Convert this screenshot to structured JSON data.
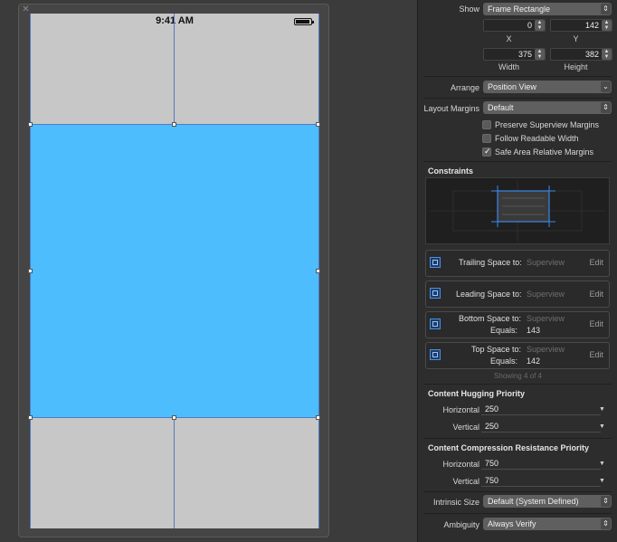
{
  "canvas": {
    "time": "9:41 AM"
  },
  "inspector": {
    "show_label": "Show",
    "show_value": "Frame Rectangle",
    "x_value": "0",
    "y_value": "142",
    "x_label": "X",
    "y_label": "Y",
    "width_value": "375",
    "height_value": "382",
    "width_label": "Width",
    "height_label": "Height",
    "arrange_label": "Arrange",
    "arrange_value": "Position View",
    "layout_margins_label": "Layout Margins",
    "layout_margins_value": "Default",
    "checkboxes": [
      {
        "label": "Preserve Superview Margins",
        "checked": false
      },
      {
        "label": "Follow Readable Width",
        "checked": false
      },
      {
        "label": "Safe Area Relative Margins",
        "checked": true
      }
    ],
    "constraints_title": "Constraints",
    "constraints": [
      {
        "label": "Trailing Space to:",
        "target": "Superview",
        "equals_label": "",
        "equals_value": "",
        "edit": "Edit"
      },
      {
        "label": "Leading Space to:",
        "target": "Superview",
        "equals_label": "",
        "equals_value": "",
        "edit": "Edit"
      },
      {
        "label": "Bottom Space to:",
        "target": "Superview",
        "equals_label": "Equals:",
        "equals_value": "143",
        "edit": "Edit"
      },
      {
        "label": "Top Space to:",
        "target": "Superview",
        "equals_label": "Equals:",
        "equals_value": "142",
        "edit": "Edit"
      }
    ],
    "showing_text": "Showing 4 of 4",
    "hugging_title": "Content Hugging Priority",
    "hugging_horizontal_label": "Horizontal",
    "hugging_horizontal_value": "250",
    "hugging_vertical_label": "Vertical",
    "hugging_vertical_value": "250",
    "compression_title": "Content Compression Resistance Priority",
    "compression_horizontal_label": "Horizontal",
    "compression_horizontal_value": "750",
    "compression_vertical_label": "Vertical",
    "compression_vertical_value": "750",
    "intrinsic_label": "Intrinsic Size",
    "intrinsic_value": "Default (System Defined)",
    "ambiguity_label": "Ambiguity",
    "ambiguity_value": "Always Verify",
    "colors": {
      "view_blue": "#4dbdfe",
      "guide_blue": "#4f7cc1"
    }
  }
}
